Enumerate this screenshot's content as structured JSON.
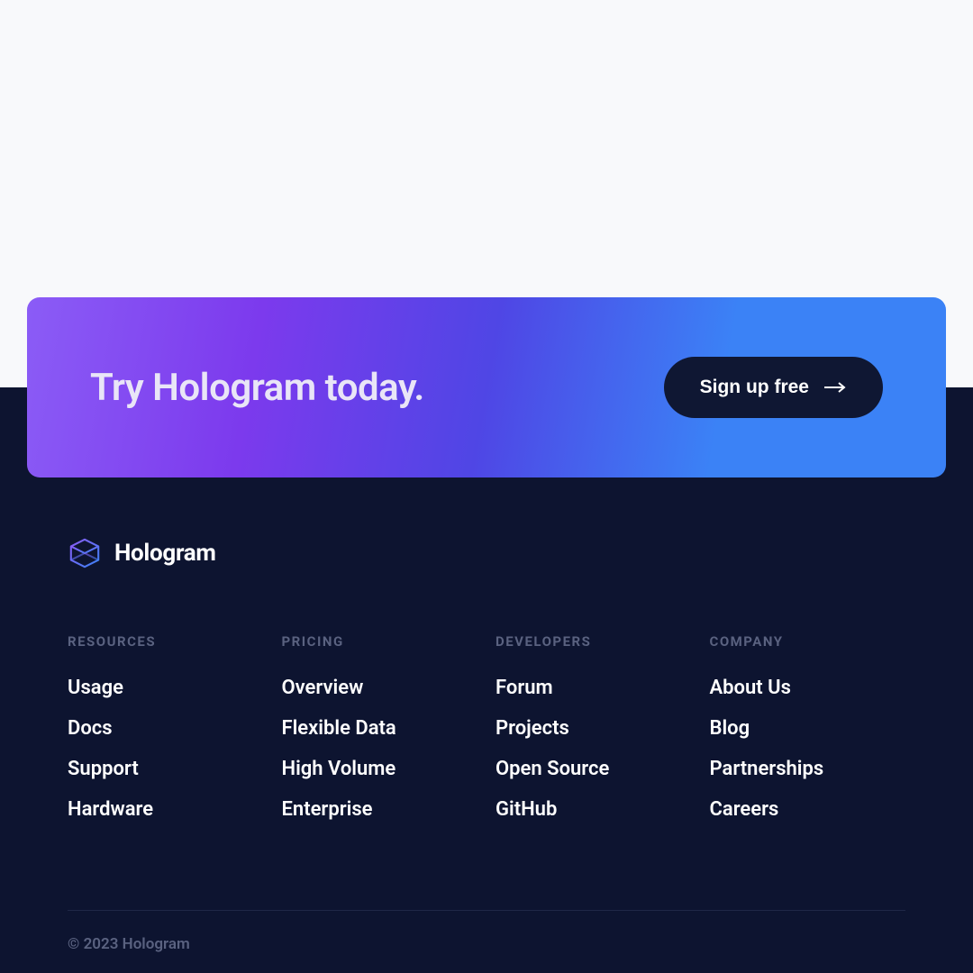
{
  "cta": {
    "title": "Try Hologram today.",
    "button_label": "Sign up free"
  },
  "brand": {
    "name": "Hologram"
  },
  "columns": [
    {
      "title": "Resources",
      "links": [
        "Usage",
        "Docs",
        "Support",
        "Hardware"
      ]
    },
    {
      "title": "Pricing",
      "links": [
        "Overview",
        "Flexible Data",
        "High Volume",
        "Enterprise"
      ]
    },
    {
      "title": "Developers",
      "links": [
        "Forum",
        "Projects",
        "Open Source",
        "GitHub"
      ]
    },
    {
      "title": "Company",
      "links": [
        "About Us",
        "Blog",
        "Partnerships",
        "Careers"
      ]
    }
  ],
  "copyright": "© 2023 Hologram"
}
